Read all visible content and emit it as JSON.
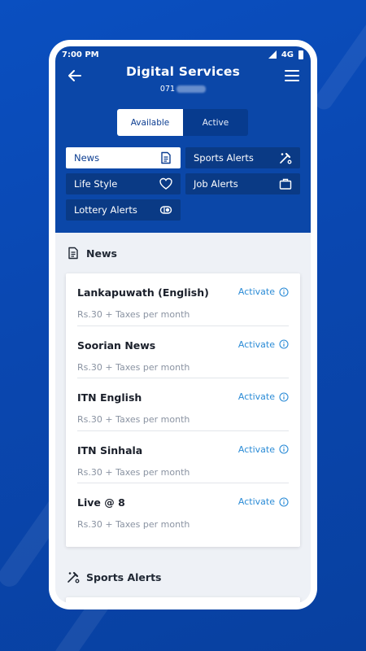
{
  "status": {
    "time": "7:00 PM",
    "network": "4G"
  },
  "header": {
    "title": "Digital Services",
    "number_prefix": "071"
  },
  "tabs": [
    {
      "label": "Available",
      "selected": true
    },
    {
      "label": "Active",
      "selected": false
    }
  ],
  "categories": [
    {
      "label": "News",
      "icon": "news-icon",
      "selected": true
    },
    {
      "label": "Sports Alerts",
      "icon": "sports-icon",
      "selected": false
    },
    {
      "label": "Life Style",
      "icon": "heart-icon",
      "selected": false
    },
    {
      "label": "Job Alerts",
      "icon": "briefcase-icon",
      "selected": false
    },
    {
      "label": "Lottery Alerts",
      "icon": "lottery-icon",
      "selected": false
    }
  ],
  "news_section": {
    "title": "News",
    "activate_label": "Activate",
    "items": [
      {
        "name": "Lankapuwath (English)",
        "price": "Rs.30 + Taxes per month"
      },
      {
        "name": "Soorian News",
        "price": "Rs.30 + Taxes per month"
      },
      {
        "name": "ITN English",
        "price": "Rs.30 + Taxes per month"
      },
      {
        "name": "ITN Sinhala",
        "price": "Rs.30 + Taxes per month"
      },
      {
        "name": "Live @ 8",
        "price": "Rs.30 + Taxes per month"
      }
    ]
  },
  "sports_section": {
    "title": "Sports Alerts"
  },
  "colors": {
    "header": "#0b47a8",
    "chip": "#0a3a85",
    "accent": "#2a8bd6",
    "background": "#0a4fc0"
  }
}
